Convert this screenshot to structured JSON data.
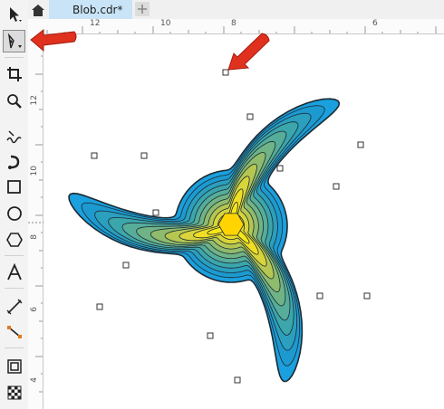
{
  "document": {
    "tab_title": "Blob.cdr*"
  },
  "toolbox": {
    "tools": [
      "pick-tool",
      "shape-tool",
      "crop-tool",
      "zoom-tool",
      "freehand-tool",
      "artistic-media-tool",
      "rectangle-tool",
      "ellipse-tool",
      "polygon-tool",
      "text-tool",
      "dimension-tool",
      "connector-tool",
      "effects-tool",
      "transparency-tool"
    ],
    "active_tool": "shape-tool"
  },
  "rulers": {
    "horizontal_labels": [
      "12",
      "10",
      "8",
      "6"
    ],
    "vertical_labels": [
      "12",
      "10",
      "8",
      "6",
      "4"
    ]
  },
  "colors": {
    "accent": "#1e8fd6",
    "callout_arrow": "#e0301e",
    "fill_outer": "#1aa0de",
    "fill_inner": "#f6e71a",
    "tab_active": "#c9e3f7"
  }
}
